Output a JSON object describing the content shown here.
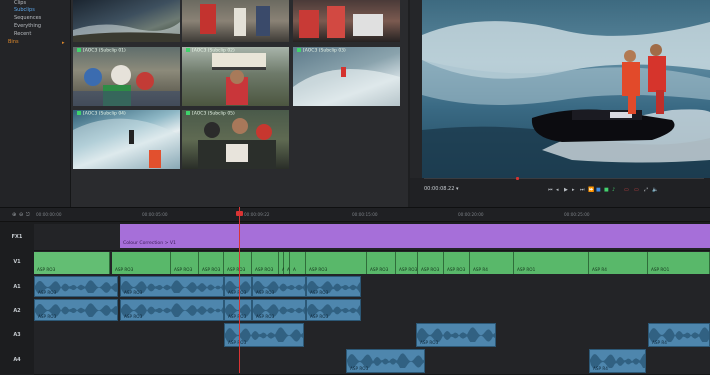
{
  "sidebar": {
    "items": [
      "Clips",
      "Subclips",
      "Sequences",
      "Everything",
      "Recent"
    ],
    "bins_label": "Bins",
    "bins_arrow": "▸"
  },
  "browser": {
    "thumbnails": [
      {
        "label": ""
      },
      {
        "label": ""
      },
      {
        "label": ""
      },
      {
        "label": "[AOC3 (Subclip 01)"
      },
      {
        "label": "[AOC3 (Subclip 02)"
      },
      {
        "label": "[AOC3 (Subclip 03)"
      },
      {
        "label": "[AOC3 (Subclip 04)"
      },
      {
        "label": "[AOC3 (Subclip 05)"
      }
    ]
  },
  "viewer": {
    "timecode": "00:00:08.22",
    "dropdown": "▾"
  },
  "timeline": {
    "tools": [
      "⊕",
      "⊖",
      "⎋"
    ],
    "ruler_ticks": [
      "00:00:00:00",
      "00:00:05:00",
      "00:00:09:22",
      "00:00:15:00",
      "00:00:20:00",
      "00:00:25:00"
    ],
    "tracks": {
      "fx1": "FX1",
      "v1": "V1",
      "a1": "A1",
      "a2": "A2",
      "a3": "A3",
      "a4": "A4"
    },
    "fx_clip_label": "Colour Correction > V1",
    "v1_clips": [
      "ASP RO3",
      "ASP RO3",
      "ASP RO3",
      "ASP RO3",
      "ASP RO3",
      "ASP RO3",
      "A",
      "A",
      "A",
      "ASP RO3",
      "ASP RO3",
      "ASP RO3",
      "ASP RO3",
      "ASP RO3",
      "ASP R4",
      "ASP RO1",
      "ASP R4",
      "ASP RO1"
    ],
    "a1_clips": [
      "ASP RO3",
      "ASP RO3",
      "ASP RO3",
      "ASP RO3",
      "ASP RO3"
    ],
    "a2_clips": [
      "ASP RO3",
      "ASP RO3",
      "ASP RO3",
      "ASP RO3",
      "ASP RO3"
    ],
    "a3_clips": [
      "ASP RO3",
      "ASP RO3",
      "ASP R4"
    ],
    "a4_clips": [
      "ASP RO3",
      "ASP R4"
    ]
  },
  "colors": {
    "video_clip": "#59b86a",
    "audio_clip": "#4e86ad",
    "fx_clip": "#a66fd9",
    "playhead": "#d93434",
    "accent": "#e08a2c"
  }
}
